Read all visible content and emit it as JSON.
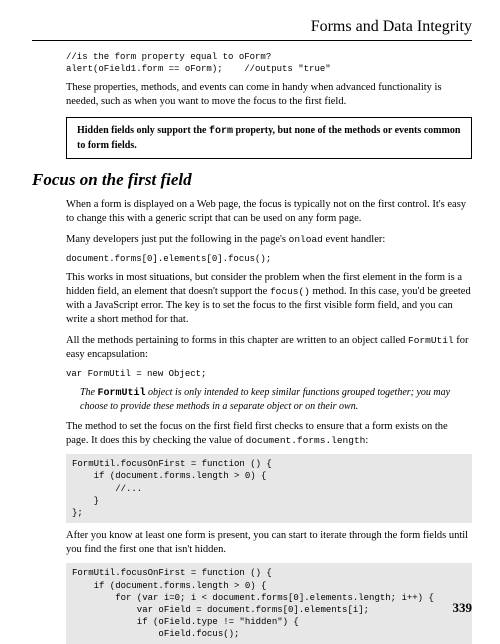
{
  "header": {
    "title": "Forms and Data Integrity"
  },
  "code1": "//is the form property equal to oForm?\nalert(oField1.form == oForm);    //outputs \"true\"",
  "para1": "These properties, methods, and events can come in handy when advanced functionality is needed, such as when you want to move the focus to the first field.",
  "notebox": {
    "pre": "Hidden fields only support the ",
    "mono": "form",
    "post": " property, but none of the methods or events common to form fields."
  },
  "sectionTitle": "Focus on the first field",
  "para2": "When a form is displayed on a Web page, the focus is typically not on the first control. It's easy to change this with a generic script that can be used on any form page.",
  "para3_pre": "Many developers just put the following in the page's ",
  "para3_mono": "onload",
  "para3_post": " event handler:",
  "code2": "document.forms[0].elements[0].focus();",
  "para4_pre": "This works in most situations, but consider the problem when the first element in the form is a hidden field, an element that doesn't support the ",
  "para4_mono": "focus()",
  "para4_post": " method. In this case, you'd be greeted with a JavaScript error. The key is to set the focus to the first visible form field, and you can write a short method for that.",
  "para5_pre": "All the methods pertaining to forms in this chapter are written to an object called ",
  "para5_mono": "FormUtil",
  "para5_post": " for easy encapsulation:",
  "code3": "var FormUtil = new Object;",
  "italicNote": {
    "pre": "The ",
    "bold": "FormUtil",
    "post": " object is only intended to keep similar functions grouped together; you may choose to provide these methods in a separate object or on their own."
  },
  "para6_pre": "The method to set the focus on the first field first checks to ensure that a form exists on the page. It does this by checking the value of ",
  "para6_mono": "document.forms.length",
  "para6_post": ":",
  "code4": "FormUtil.focusOnFirst = function () {\n    if (document.forms.length > 0) {\n        //...\n    }\n};",
  "para7": "After you know at least one form is present, you can start to iterate through the form fields until you find the first one that isn't hidden.",
  "code5": "FormUtil.focusOnFirst = function () {\n    if (document.forms.length > 0) {\n        for (var i=0; i < document.forms[0].elements.length; i++) {\n            var oField = document.forms[0].elements[i];\n            if (oField.type != \"hidden\") {\n                oField.focus();",
  "pageNumber": "339"
}
